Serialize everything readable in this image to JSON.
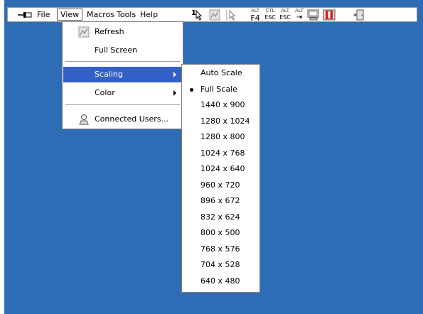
{
  "colors": {
    "desktop": "#2e6db5",
    "highlight": "#3260c8",
    "menu_bg": "#ffffff"
  },
  "toolbar": {
    "menus": [
      "File",
      "View",
      "Macros",
      "Tools",
      "Help"
    ],
    "active_menu": "View",
    "key_icons": [
      {
        "top": "ALT",
        "bottom": "F4"
      },
      {
        "top": "CTL",
        "bottom": "ESC"
      },
      {
        "top": "ALT",
        "bottom": "ESC"
      },
      {
        "top": "ALT",
        "bottom": "⇥"
      }
    ],
    "icons": [
      "pin-icon",
      "single-cursor-icon",
      "refresh-icon",
      "dual-cursor-icon",
      "alt-f4-icon",
      "ctl-esc-icon",
      "alt-esc-icon",
      "alt-tab-icon",
      "monitor-icon",
      "exit-user-icon",
      "door-exit-icon"
    ],
    "cursor_one_label": "1"
  },
  "view_menu": {
    "items": [
      {
        "label": "Refresh",
        "icon": "refresh-icon"
      },
      {
        "label": "Full Screen",
        "icon": ""
      },
      {
        "label": "Scaling",
        "highlighted": true,
        "has_submenu": true
      },
      {
        "label": "Color",
        "has_submenu": true
      },
      {
        "label": "Connected Users...",
        "icon": "users-icon"
      }
    ]
  },
  "scaling_menu": {
    "selected": "Full Scale",
    "items": [
      "Auto Scale",
      "Full Scale",
      "1440 x 900",
      "1280 x 1024",
      "1280 x 800",
      "1024 x 768",
      "1024 x 640",
      "960 x 720",
      "896 x 672",
      "832 x 624",
      "800 x 500",
      "768 x 576",
      "704 x 528",
      "640 x 480"
    ]
  }
}
